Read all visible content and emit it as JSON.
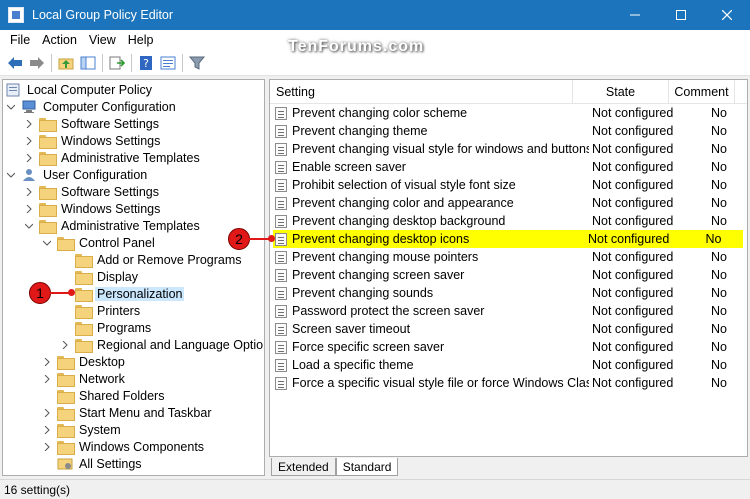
{
  "window": {
    "title": "Local Group Policy Editor"
  },
  "brand": "TenForums.com",
  "menu": [
    "File",
    "Action",
    "View",
    "Help"
  ],
  "toolbar": {
    "buttons": [
      "back-icon",
      "forward-icon",
      "up-folder-icon",
      "show-hide-tree-icon",
      "export-list-icon",
      "help-icon",
      "properties-icon",
      "filter-icon"
    ]
  },
  "tree": {
    "root": "Local Computer Policy",
    "items": [
      {
        "label": "Computer Configuration",
        "icon": "computer-icon"
      },
      {
        "label": "Software Settings"
      },
      {
        "label": "Windows Settings"
      },
      {
        "label": "Administrative Templates"
      },
      {
        "label": "User Configuration",
        "icon": "user-icon"
      },
      {
        "label": "Software Settings"
      },
      {
        "label": "Windows Settings"
      },
      {
        "label": "Administrative Templates"
      },
      {
        "label": "Control Panel"
      },
      {
        "label": "Add or Remove Programs"
      },
      {
        "label": "Display"
      },
      {
        "label": "Personalization"
      },
      {
        "label": "Printers"
      },
      {
        "label": "Programs"
      },
      {
        "label": "Regional and Language Options"
      },
      {
        "label": "Desktop"
      },
      {
        "label": "Network"
      },
      {
        "label": "Shared Folders"
      },
      {
        "label": "Start Menu and Taskbar"
      },
      {
        "label": "System"
      },
      {
        "label": "Windows Components"
      },
      {
        "label": "All Settings"
      }
    ]
  },
  "list": {
    "columns": {
      "setting": "Setting",
      "state": "State",
      "comment": "Comment"
    },
    "rows": [
      {
        "name": "Prevent changing color scheme",
        "state": "Not configured",
        "comment": "No"
      },
      {
        "name": "Prevent changing theme",
        "state": "Not configured",
        "comment": "No"
      },
      {
        "name": "Prevent changing visual style for windows and buttons",
        "state": "Not configured",
        "comment": "No"
      },
      {
        "name": "Enable screen saver",
        "state": "Not configured",
        "comment": "No"
      },
      {
        "name": "Prohibit selection of visual style font size",
        "state": "Not configured",
        "comment": "No"
      },
      {
        "name": "Prevent changing color and appearance",
        "state": "Not configured",
        "comment": "No"
      },
      {
        "name": "Prevent changing desktop background",
        "state": "Not configured",
        "comment": "No"
      },
      {
        "name": "Prevent changing desktop icons",
        "state": "Not configured",
        "comment": "No"
      },
      {
        "name": "Prevent changing mouse pointers",
        "state": "Not configured",
        "comment": "No"
      },
      {
        "name": "Prevent changing screen saver",
        "state": "Not configured",
        "comment": "No"
      },
      {
        "name": "Prevent changing sounds",
        "state": "Not configured",
        "comment": "No"
      },
      {
        "name": "Password protect the screen saver",
        "state": "Not configured",
        "comment": "No"
      },
      {
        "name": "Screen saver timeout",
        "state": "Not configured",
        "comment": "No"
      },
      {
        "name": "Force specific screen saver",
        "state": "Not configured",
        "comment": "No"
      },
      {
        "name": "Load a specific theme",
        "state": "Not configured",
        "comment": "No"
      },
      {
        "name": "Force a specific visual style file or force Windows Classic",
        "state": "Not configured",
        "comment": "No"
      }
    ]
  },
  "tabs": [
    "Extended",
    "Standard"
  ],
  "status": "16 setting(s)",
  "markers": [
    "1",
    "2"
  ],
  "colors": {
    "titlebar": "#1c75bc",
    "highlight": "#ffff00",
    "selection": "#cce8ff",
    "marker": "#e01818"
  }
}
